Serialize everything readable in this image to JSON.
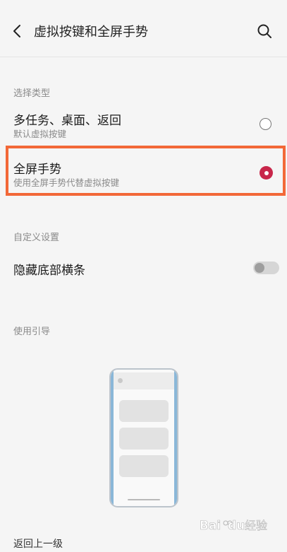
{
  "header": {
    "title": "虚拟按键和全屏手势",
    "back_icon": "chevron-left-icon",
    "search_icon": "search-icon"
  },
  "select_type": {
    "label": "选择类型",
    "options": [
      {
        "title": "多任务、桌面、返回",
        "subtitle": "默认虚拟按键",
        "selected": false
      },
      {
        "title": "全屏手势",
        "subtitle": "使用全屏手势代替虚拟按键",
        "selected": true
      }
    ]
  },
  "custom_settings": {
    "label": "自定义设置",
    "hide_bottom_bar": {
      "label": "隐藏底部横条",
      "enabled": false
    }
  },
  "usage_guide": {
    "label": "使用引导"
  },
  "footer": {
    "back_link": "返回上一级"
  },
  "watermark": {
    "text": "Baidu经验"
  },
  "colors": {
    "accent": "#c8264a",
    "highlight": "#f26838",
    "background": "#f5f5f5"
  }
}
